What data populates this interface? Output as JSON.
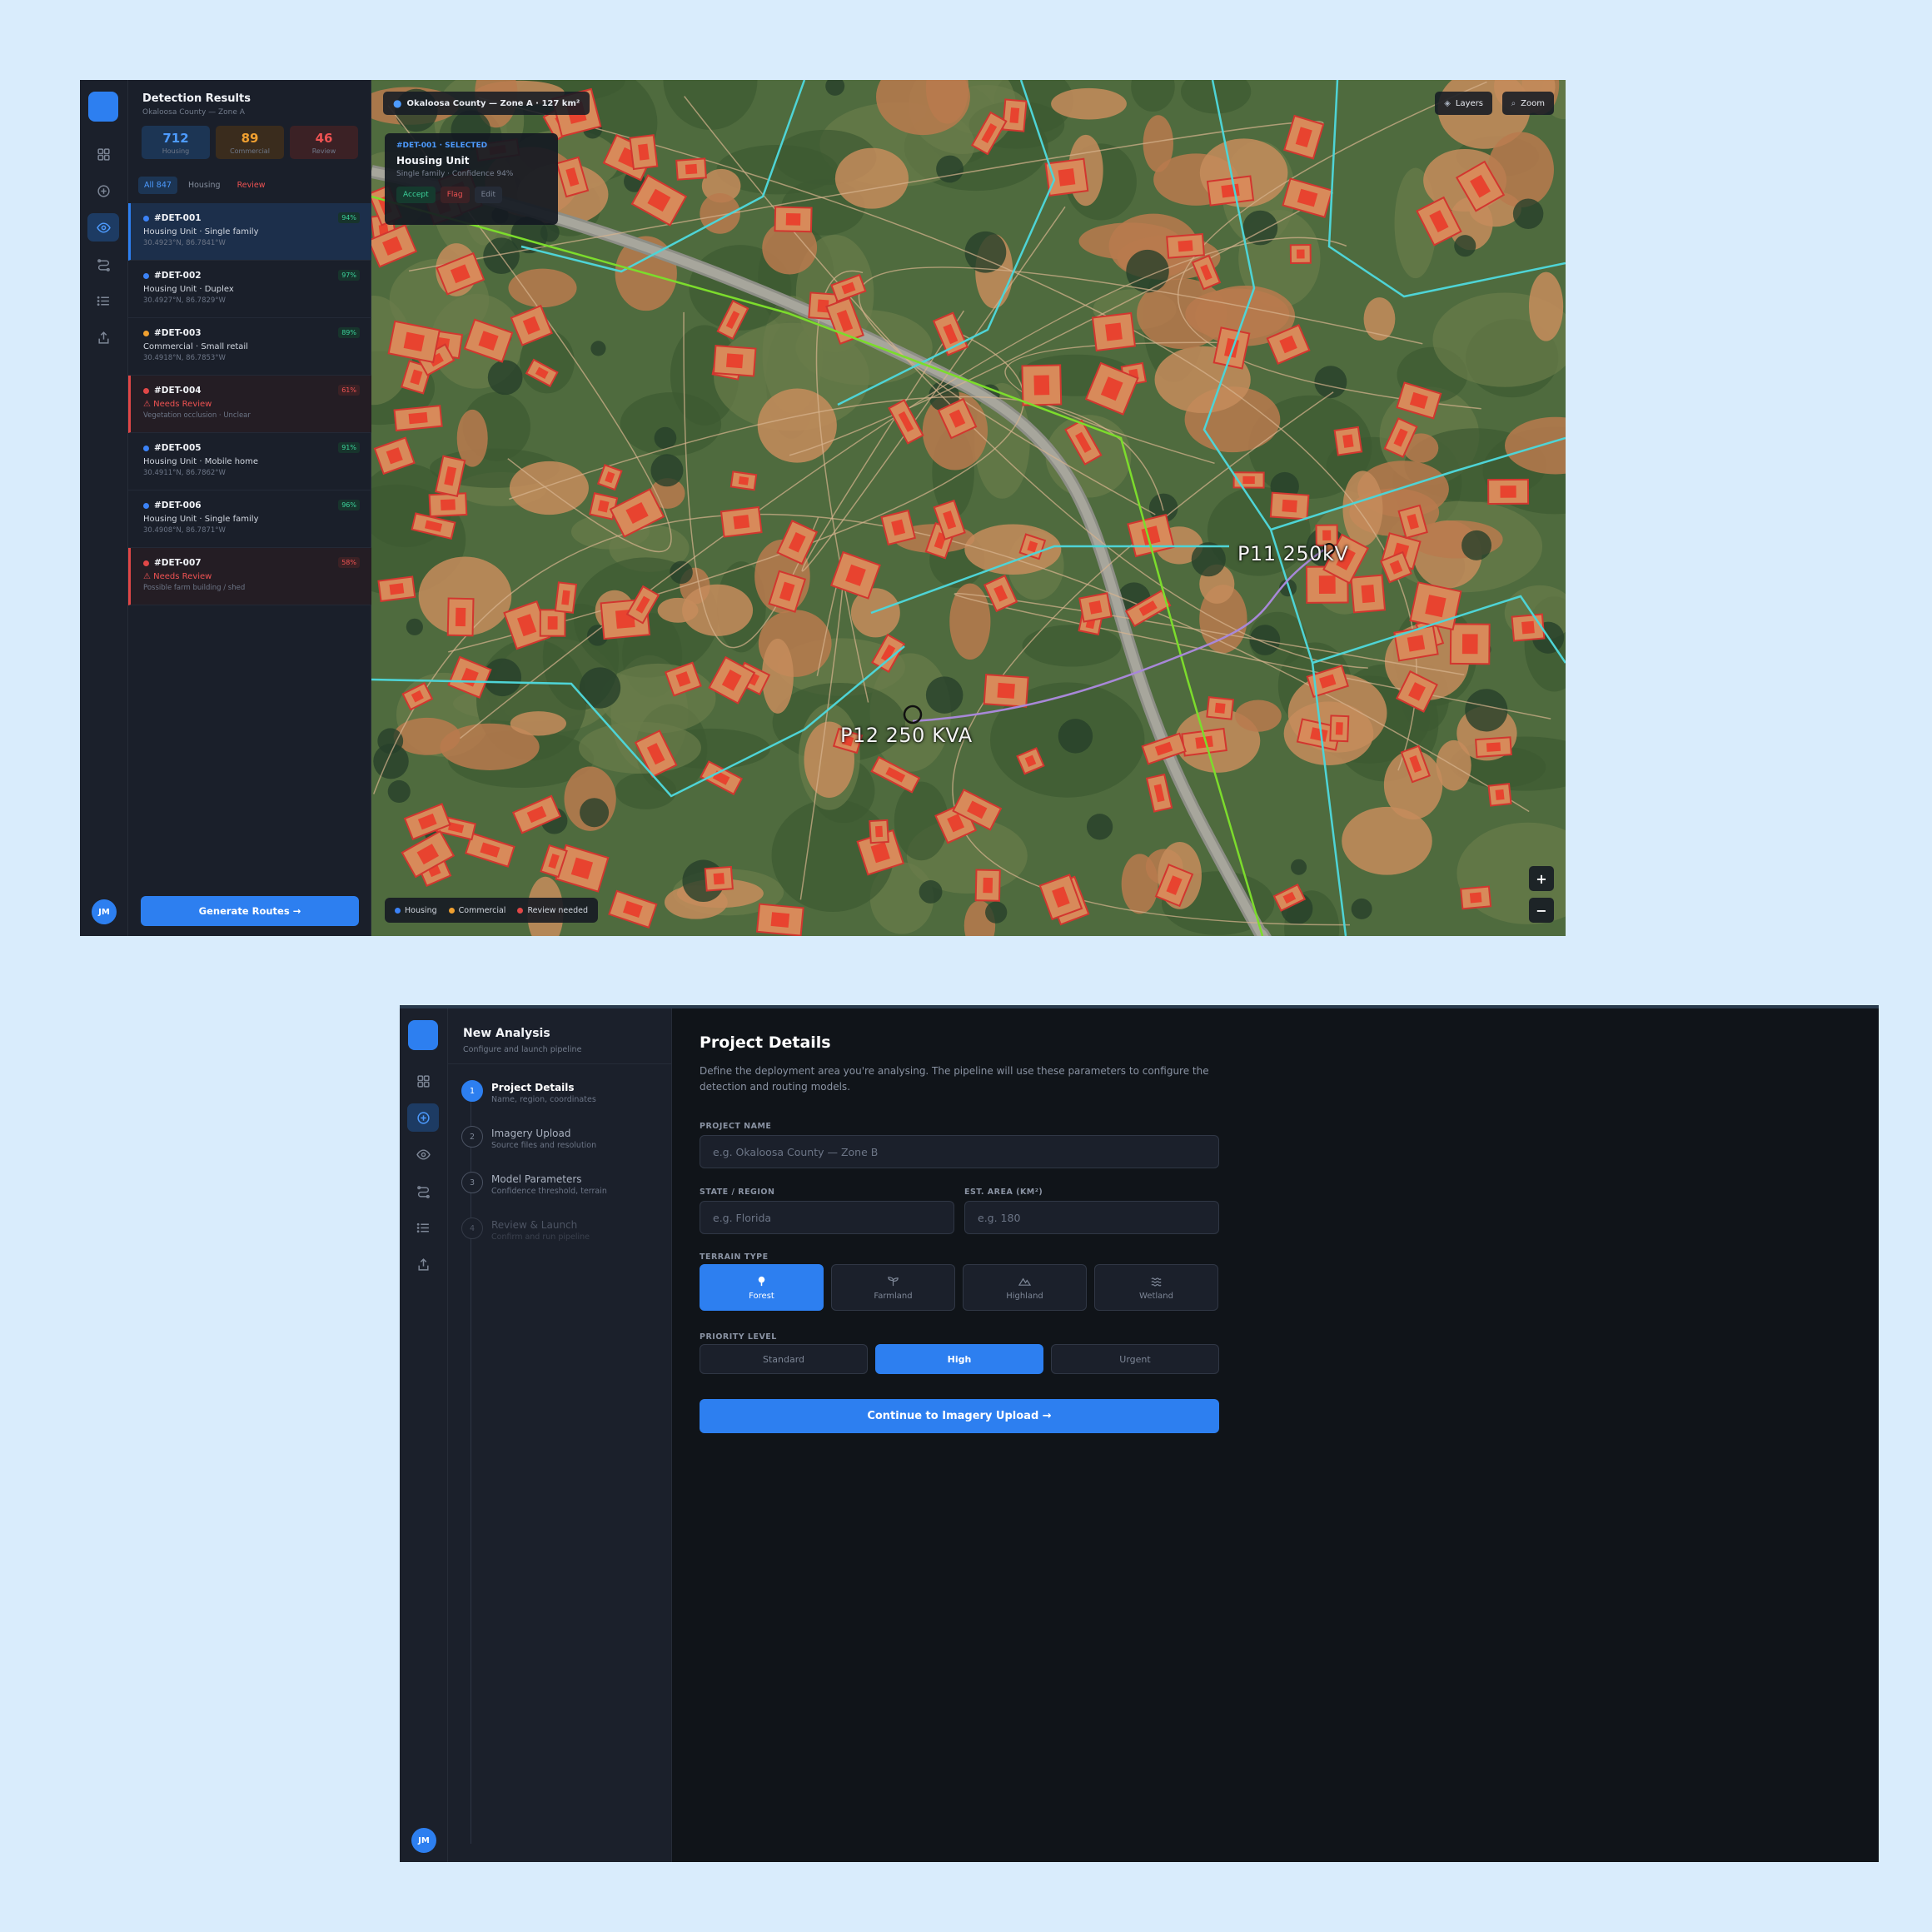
{
  "detection": {
    "title": "Detection Results",
    "subtitle": "Okaloosa County — Zone A",
    "stats": [
      {
        "value": "712",
        "label": "Housing"
      },
      {
        "value": "89",
        "label": "Commercial"
      },
      {
        "value": "46",
        "label": "Review"
      }
    ],
    "tabs": [
      "All 847",
      "Housing",
      "Review"
    ],
    "items": [
      {
        "id": "#DET-001",
        "line1": "Housing Unit · Single family",
        "line2": "30.4923°N, 86.7841°W",
        "conf": "94%",
        "type": "housing",
        "state": "selected"
      },
      {
        "id": "#DET-002",
        "line1": "Housing Unit · Duplex",
        "line2": "30.4927°N, 86.7829°W",
        "conf": "97%",
        "type": "housing",
        "state": "normal"
      },
      {
        "id": "#DET-003",
        "line1": "Commercial · Small retail",
        "line2": "30.4918°N, 86.7853°W",
        "conf": "89%",
        "type": "commercial",
        "state": "normal"
      },
      {
        "id": "#DET-004",
        "line1": "⚠ Needs Review",
        "line2": "Vegetation occlusion · Unclear",
        "conf": "61%",
        "type": "review",
        "state": "warn"
      },
      {
        "id": "#DET-005",
        "line1": "Housing Unit · Mobile home",
        "line2": "30.4911°N, 86.7862°W",
        "conf": "91%",
        "type": "housing",
        "state": "normal"
      },
      {
        "id": "#DET-006",
        "line1": "Housing Unit · Single family",
        "line2": "30.4908°N, 86.7871°W",
        "conf": "96%",
        "type": "housing",
        "state": "normal"
      },
      {
        "id": "#DET-007",
        "line1": "⚠ Needs Review",
        "line2": "Possible farm building / shed",
        "conf": "58%",
        "type": "review",
        "state": "warn"
      }
    ],
    "generate_label": "Generate Routes →",
    "avatar": "JM"
  },
  "map": {
    "location": "Okaloosa County — Zone A · 127 km²",
    "layers_label": "Layers",
    "zoom_label": "Zoom",
    "popup": {
      "key": "#DET-001 · SELECTED",
      "title": "Housing Unit",
      "sub": "Single family · Confidence 94%",
      "accept": "Accept",
      "flag": "Flag",
      "edit": "Edit"
    },
    "legend": [
      "Housing",
      "Commercial",
      "Review needed"
    ],
    "labels": [
      "P11  250kV",
      "P12   250 KVA"
    ],
    "zoom_in": "+",
    "zoom_out": "−"
  },
  "analysis": {
    "title": "New Analysis",
    "subtitle": "Configure and launch pipeline",
    "steps": [
      {
        "num": "1",
        "title": "Project Details",
        "sub": "Name, region, coordinates"
      },
      {
        "num": "2",
        "title": "Imagery Upload",
        "sub": "Source files and resolution"
      },
      {
        "num": "3",
        "title": "Model Parameters",
        "sub": "Confidence threshold, terrain"
      },
      {
        "num": "4",
        "title": "Review & Launch",
        "sub": "Confirm and run pipeline"
      }
    ],
    "avatar": "JM"
  },
  "form": {
    "title": "Project Details",
    "description": "Define the deployment area you're analysing. The pipeline will use these parameters to configure the detection and routing models.",
    "project_name_label": "PROJECT NAME",
    "project_name_placeholder": "e.g. Okaloosa County — Zone B",
    "state_label": "STATE / REGION",
    "state_placeholder": "e.g. Florida",
    "area_label": "EST. AREA (KM²)",
    "area_placeholder": "e.g. 180",
    "terrain_label": "TERRAIN TYPE",
    "terrain_options": [
      "Forest",
      "Farmland",
      "Highland",
      "Wetland"
    ],
    "terrain_selected": "Forest",
    "priority_label": "PRIORITY LEVEL",
    "priority_options": [
      "Standard",
      "High",
      "Urgent"
    ],
    "priority_selected": "High",
    "continue_label": "Continue to Imagery Upload →"
  },
  "colors": {
    "accent": "#2d7ff0",
    "housing": "#3b82f6",
    "commercial": "#f0a030",
    "review": "#e04747",
    "success": "#3bd29a"
  }
}
